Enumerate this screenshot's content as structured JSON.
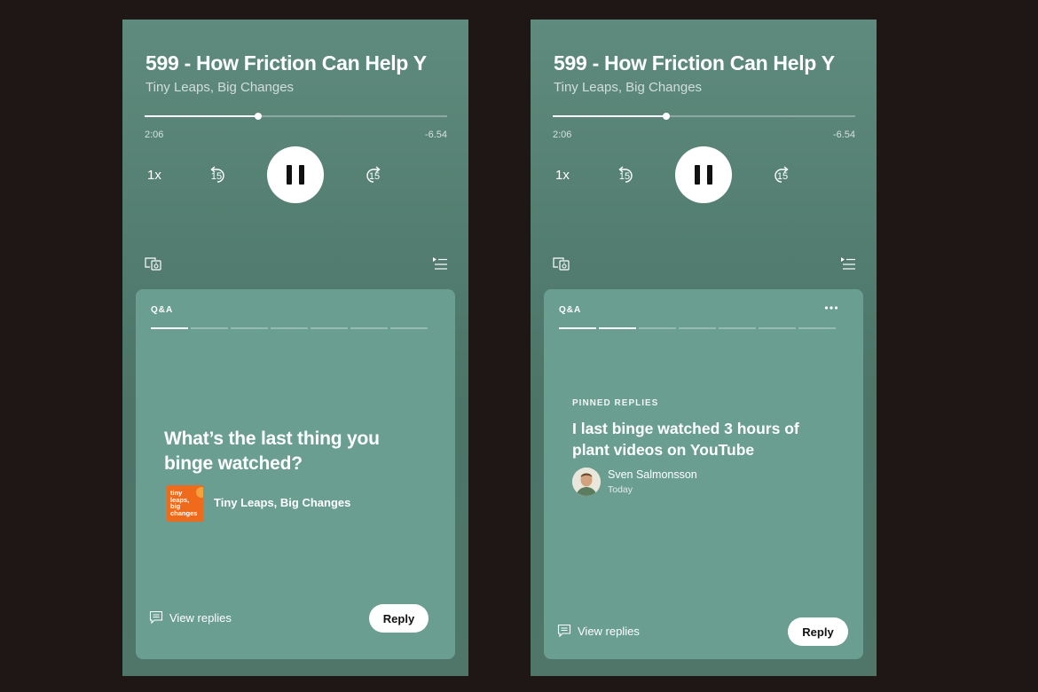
{
  "screens": [
    {
      "episode_title": "599 - How Friction Can Help Y",
      "show_name": "Tiny Leaps, Big Changes",
      "progress_fraction": 0.375,
      "elapsed": "2:06",
      "remaining": "-6.54",
      "speed": "1x",
      "skip_back_seconds": "15",
      "skip_forward_seconds": "15",
      "card": {
        "label": "Q&A",
        "segments_total": 7,
        "segments_done": 1,
        "question": "What’s the last thing you binge watched?",
        "cover_text": "tiny leaps, big changes",
        "show_name": "Tiny Leaps, Big Changes",
        "view_replies": "View replies",
        "reply": "Reply"
      }
    },
    {
      "episode_title": "599 - How Friction Can Help Y",
      "show_name": "Tiny Leaps, Big Changes",
      "progress_fraction": 0.375,
      "elapsed": "2:06",
      "remaining": "-6.54",
      "speed": "1x",
      "skip_back_seconds": "15",
      "skip_forward_seconds": "15",
      "card": {
        "label": "Q&A",
        "segments_total": 7,
        "segments_done": 2,
        "pinned_label": "PINNED REPLIES",
        "reply_text": "I last binge watched 3 hours of plant videos on YouTube",
        "author": "Sven Salmonsson",
        "when": "Today",
        "view_replies": "View replies",
        "reply": "Reply"
      }
    }
  ],
  "colors": {
    "page_background": "#1e1715",
    "screen_background": "#5a8577",
    "card_background": "#6a9e90",
    "cover_orange": "#ef6a1a"
  }
}
